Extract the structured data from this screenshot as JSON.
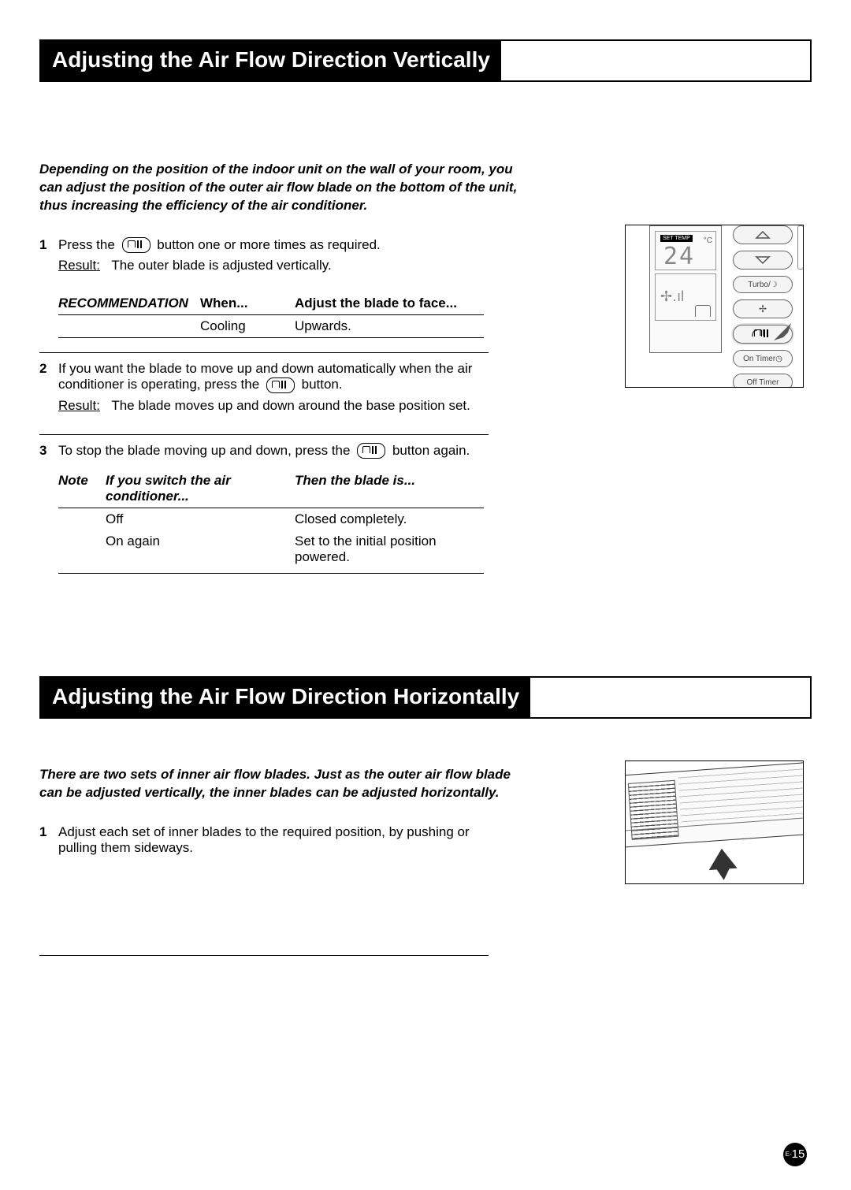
{
  "section1": {
    "title": "Adjusting the Air Flow Direction Vertically",
    "intro": "Depending on the position of the indoor unit on the wall of your room, you can adjust the position of the outer air flow blade on the bottom of the unit, thus increasing the efficiency of the air conditioner.",
    "step1": {
      "num": "1",
      "text_before": "Press the",
      "text_after": "button one or more times as required.",
      "result_label": "Result",
      "result_text": "The outer blade is adjusted vertically."
    },
    "recommendation": {
      "label": "RECOMMENDATION",
      "col_when": "When...",
      "col_adjust": "Adjust the blade to face...",
      "row_when": "Cooling",
      "row_adjust": "Upwards."
    },
    "step2": {
      "num": "2",
      "text_1a": "If you want the blade to move up and down automatically when the air conditioner is operating, press the",
      "text_1b": "button.",
      "result_label": "Result",
      "result_text": "The blade moves up and down around the base position set."
    },
    "step3": {
      "num": "3",
      "text_a": "To stop the blade moving up and down, press the",
      "text_b": "button again."
    },
    "note": {
      "label": "Note",
      "col_if": "If you switch the air conditioner...",
      "col_then": "Then the blade is...",
      "r1_if": "Off",
      "r1_then": "Closed completely.",
      "r2_if": "On again",
      "r2_then": "Set to the initial position powered."
    },
    "remote": {
      "set_temp": "SET TEMP",
      "temp": "24",
      "deg": "°C",
      "turbo": "Turbo",
      "on_timer": "On Timer",
      "off_timer": "Off Timer"
    }
  },
  "section2": {
    "title": "Adjusting the Air Flow Direction Horizontally",
    "intro": "There are two sets of inner air flow blades. Just as the outer air flow blade can be adjusted vertically, the inner blades can be adjusted horizontally.",
    "step1": {
      "num": "1",
      "text": "Adjust each set of inner blades to the required position, by pushing or pulling them sideways."
    }
  },
  "page_num_prefix": "E-",
  "page_num": "15"
}
